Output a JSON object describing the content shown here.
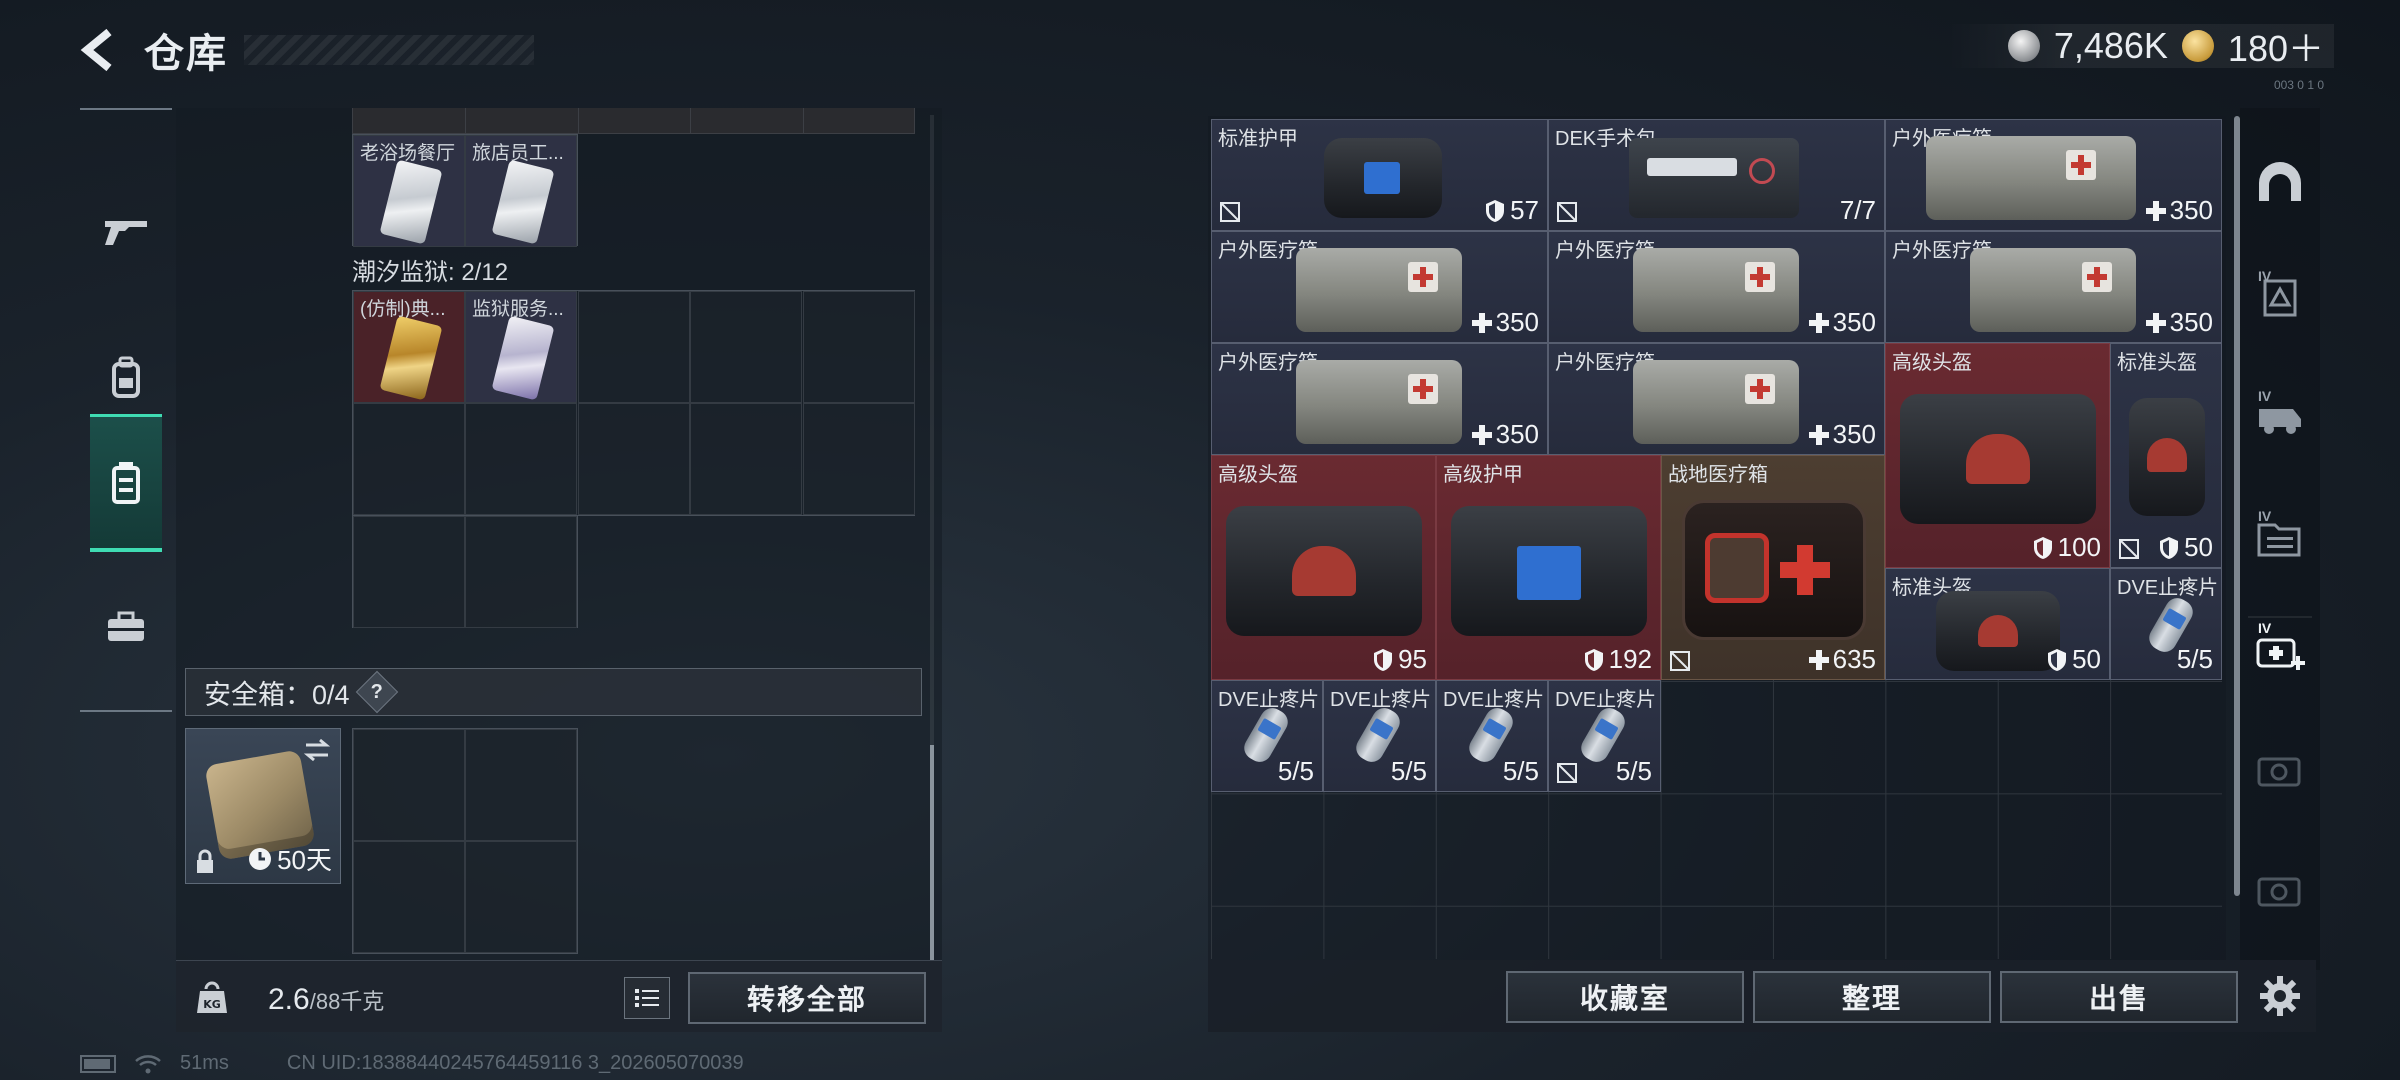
{
  "header": {
    "title": "仓库"
  },
  "currency": {
    "silver": "7,486K",
    "gold": "180＋",
    "small_id": "003 0 1 0"
  },
  "container": {
    "row1_items": [
      {
        "label": "老浴场餐厅"
      },
      {
        "label": "旅店员工..."
      }
    ],
    "section2_label": "潮汐监狱: 2/12",
    "row2_items": [
      {
        "label": "(仿制)典..."
      },
      {
        "label": "监狱服务..."
      }
    ],
    "safe_box_label": "安全箱：0/4",
    "help_label": "?",
    "safe_item_days": "50天"
  },
  "bottom_left": {
    "weight_current": "2.6",
    "weight_max": "/88千克",
    "transfer_all": "转移全部"
  },
  "stash_items": [
    {
      "name": "标准护甲",
      "value": "57"
    },
    {
      "name": "DEK手术包",
      "value": "7/7"
    },
    {
      "name": "户外医疗箱",
      "value": "350"
    },
    {
      "name": "户外医疗箱",
      "value": "350"
    },
    {
      "name": "户外医疗箱",
      "value": "350"
    },
    {
      "name": "户外医疗箱",
      "value": "350"
    },
    {
      "name": "户外医疗箱",
      "value": "350"
    },
    {
      "name": "户外医疗箱",
      "value": "350"
    },
    {
      "name": "高级头盔",
      "value": "100"
    },
    {
      "name": "标准头盔",
      "value": "50"
    },
    {
      "name": "高级头盔",
      "value": "95"
    },
    {
      "name": "高级护甲",
      "value": "192"
    },
    {
      "name": "战地医疗箱",
      "value": "635"
    },
    {
      "name": "标准头盔",
      "value": "50"
    },
    {
      "name": "DVE止疼片",
      "value": "5/5"
    },
    {
      "name": "DVE止疼片",
      "value": "5/5"
    },
    {
      "name": "DVE止疼片",
      "value": "5/5"
    },
    {
      "name": "DVE止疼片",
      "value": "5/5"
    },
    {
      "name": "DVE止疼片",
      "value": "5/5"
    }
  ],
  "right_nav": {
    "tiers": [
      "IV",
      "IV",
      "IV",
      "IV"
    ]
  },
  "bottom_right": {
    "collection": "收藏室",
    "organize": "整理",
    "sell": "出售"
  },
  "status": {
    "ping": "51ms",
    "uid": "CN UID:18388440245764459116 3_202605070039"
  },
  "colors": {
    "accent": "#3fdcb3",
    "red_rarity": "#6a2a31",
    "blue_rarity": "#2d3346",
    "brown_rarity": "#4d3e31"
  }
}
